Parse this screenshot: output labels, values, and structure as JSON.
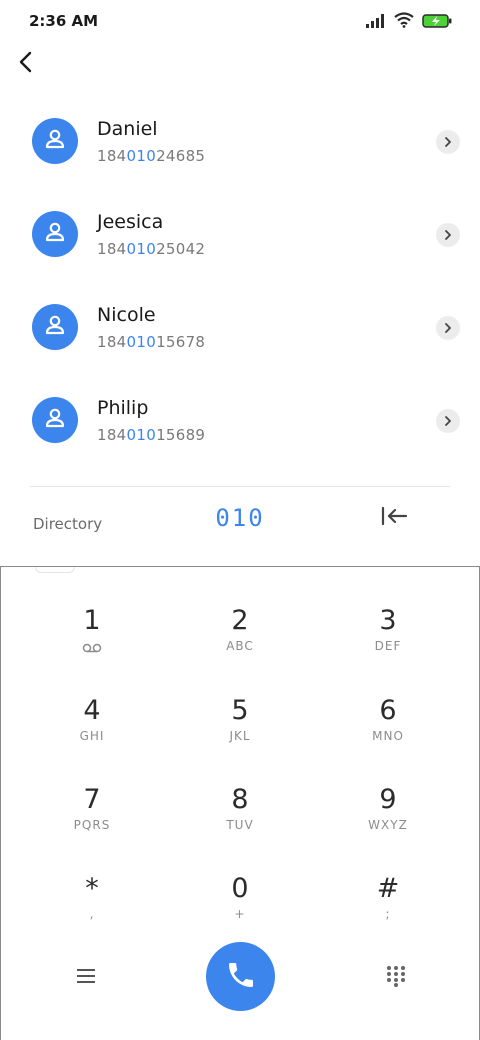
{
  "status_bar": {
    "time": "2:36 AM",
    "icons": [
      "signal-icon",
      "wifi-icon",
      "battery-charging-icon"
    ],
    "battery_color": "#4cd137"
  },
  "navigation": {
    "back_icon": "chevron-left-icon"
  },
  "contacts": [
    {
      "name": "Daniel",
      "number_prefix": "184",
      "number_match": "010",
      "number_suffix": "24685"
    },
    {
      "name": "Jeesica",
      "number_prefix": "184",
      "number_match": "010",
      "number_suffix": "25042"
    },
    {
      "name": "Nicole",
      "number_prefix": "184",
      "number_match": "010",
      "number_suffix": "15678"
    },
    {
      "name": "Philip",
      "number_prefix": "184",
      "number_match": "010",
      "number_suffix": "15689"
    }
  ],
  "dial_bar": {
    "directory_label": "Directory",
    "dialed_number": "010",
    "backspace_icon": "backspace-icon"
  },
  "keypad": [
    {
      "digit": "1",
      "letters": ""
    },
    {
      "digit": "2",
      "letters": "ABC"
    },
    {
      "digit": "3",
      "letters": "DEF"
    },
    {
      "digit": "4",
      "letters": "GHI"
    },
    {
      "digit": "5",
      "letters": "JKL"
    },
    {
      "digit": "6",
      "letters": "MNO"
    },
    {
      "digit": "7",
      "letters": "PQRS"
    },
    {
      "digit": "8",
      "letters": "TUV"
    },
    {
      "digit": "9",
      "letters": "WXYZ"
    },
    {
      "digit": "*",
      "letters": ","
    },
    {
      "digit": "0",
      "letters": "+"
    },
    {
      "digit": "#",
      "letters": ";"
    }
  ],
  "bottom_bar": {
    "menu_icon": "menu-icon",
    "call_icon": "phone-icon",
    "keypad_icon": "dialpad-icon"
  },
  "colors": {
    "accent": "#3c85ec",
    "text_primary": "#1a1a1a",
    "text_secondary": "#7a7a7a"
  }
}
